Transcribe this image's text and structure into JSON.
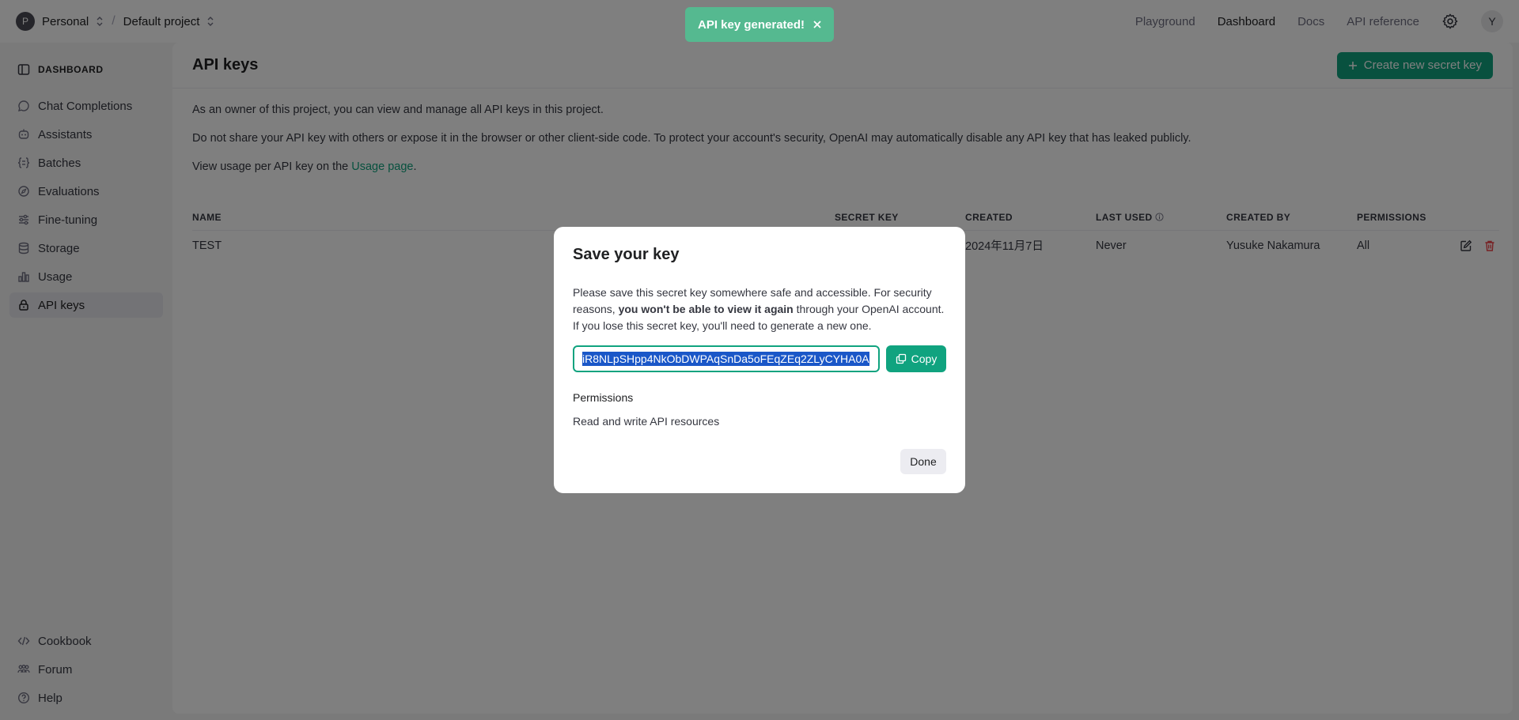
{
  "topbar": {
    "org_initial": "P",
    "org_name": "Personal",
    "separator": "/",
    "project_name": "Default project",
    "nav": [
      "Playground",
      "Dashboard",
      "Docs",
      "API reference"
    ],
    "active_nav": "Dashboard",
    "user_initial": "Y"
  },
  "toast": {
    "message": "API key generated!"
  },
  "sidebar": {
    "heading": "DASHBOARD",
    "items": [
      {
        "label": "Chat Completions",
        "icon": "chat-icon"
      },
      {
        "label": "Assistants",
        "icon": "assistant-icon"
      },
      {
        "label": "Batches",
        "icon": "batches-icon"
      },
      {
        "label": "Evaluations",
        "icon": "evaluations-icon"
      },
      {
        "label": "Fine-tuning",
        "icon": "fine-tuning-icon"
      },
      {
        "label": "Storage",
        "icon": "storage-icon"
      },
      {
        "label": "Usage",
        "icon": "usage-icon"
      },
      {
        "label": "API keys",
        "icon": "lock-icon",
        "active": true
      }
    ],
    "bottom": [
      {
        "label": "Cookbook",
        "icon": "code-icon"
      },
      {
        "label": "Forum",
        "icon": "forum-icon"
      },
      {
        "label": "Help",
        "icon": "help-icon"
      }
    ]
  },
  "main": {
    "title": "API keys",
    "create_label": "Create new secret key",
    "desc1": "As an owner of this project, you can view and manage all API keys in this project.",
    "desc2": "Do not share your API key with others or expose it in the browser or other client-side code. To protect your account's security, OpenAI may automatically disable any API key that has leaked publicly.",
    "desc3_prefix": "View usage per API key on the ",
    "desc3_link": "Usage page",
    "desc3_suffix": ".",
    "table": {
      "headers": [
        "NAME",
        "SECRET KEY",
        "CREATED",
        "LAST USED",
        "CREATED BY",
        "PERMISSIONS"
      ],
      "rows": [
        {
          "name": "TEST",
          "secret": "",
          "created": "2024年11月7日",
          "last_used": "Never",
          "created_by": "Yusuke Nakamura",
          "permissions": "All"
        }
      ]
    }
  },
  "modal": {
    "title": "Save your key",
    "msg_part1": "Please save this secret key somewhere safe and accessible. For security reasons, ",
    "msg_bold": "you won't be able to view it again",
    "msg_part2": " through your OpenAI account. If you lose this secret key, you'll need to generate a new one.",
    "key_value": "iR8NLpSHpp4NkObDWPAqSnDa5oFEqZEq2ZLyCYHA0A",
    "copy_label": "Copy",
    "permissions_label": "Permissions",
    "permissions_value": "Read and write API resources",
    "done_label": "Done"
  },
  "colors": {
    "accent": "#10a37f",
    "toast": "#55b990",
    "danger": "#ef4146",
    "selection": "#1a57c8"
  }
}
